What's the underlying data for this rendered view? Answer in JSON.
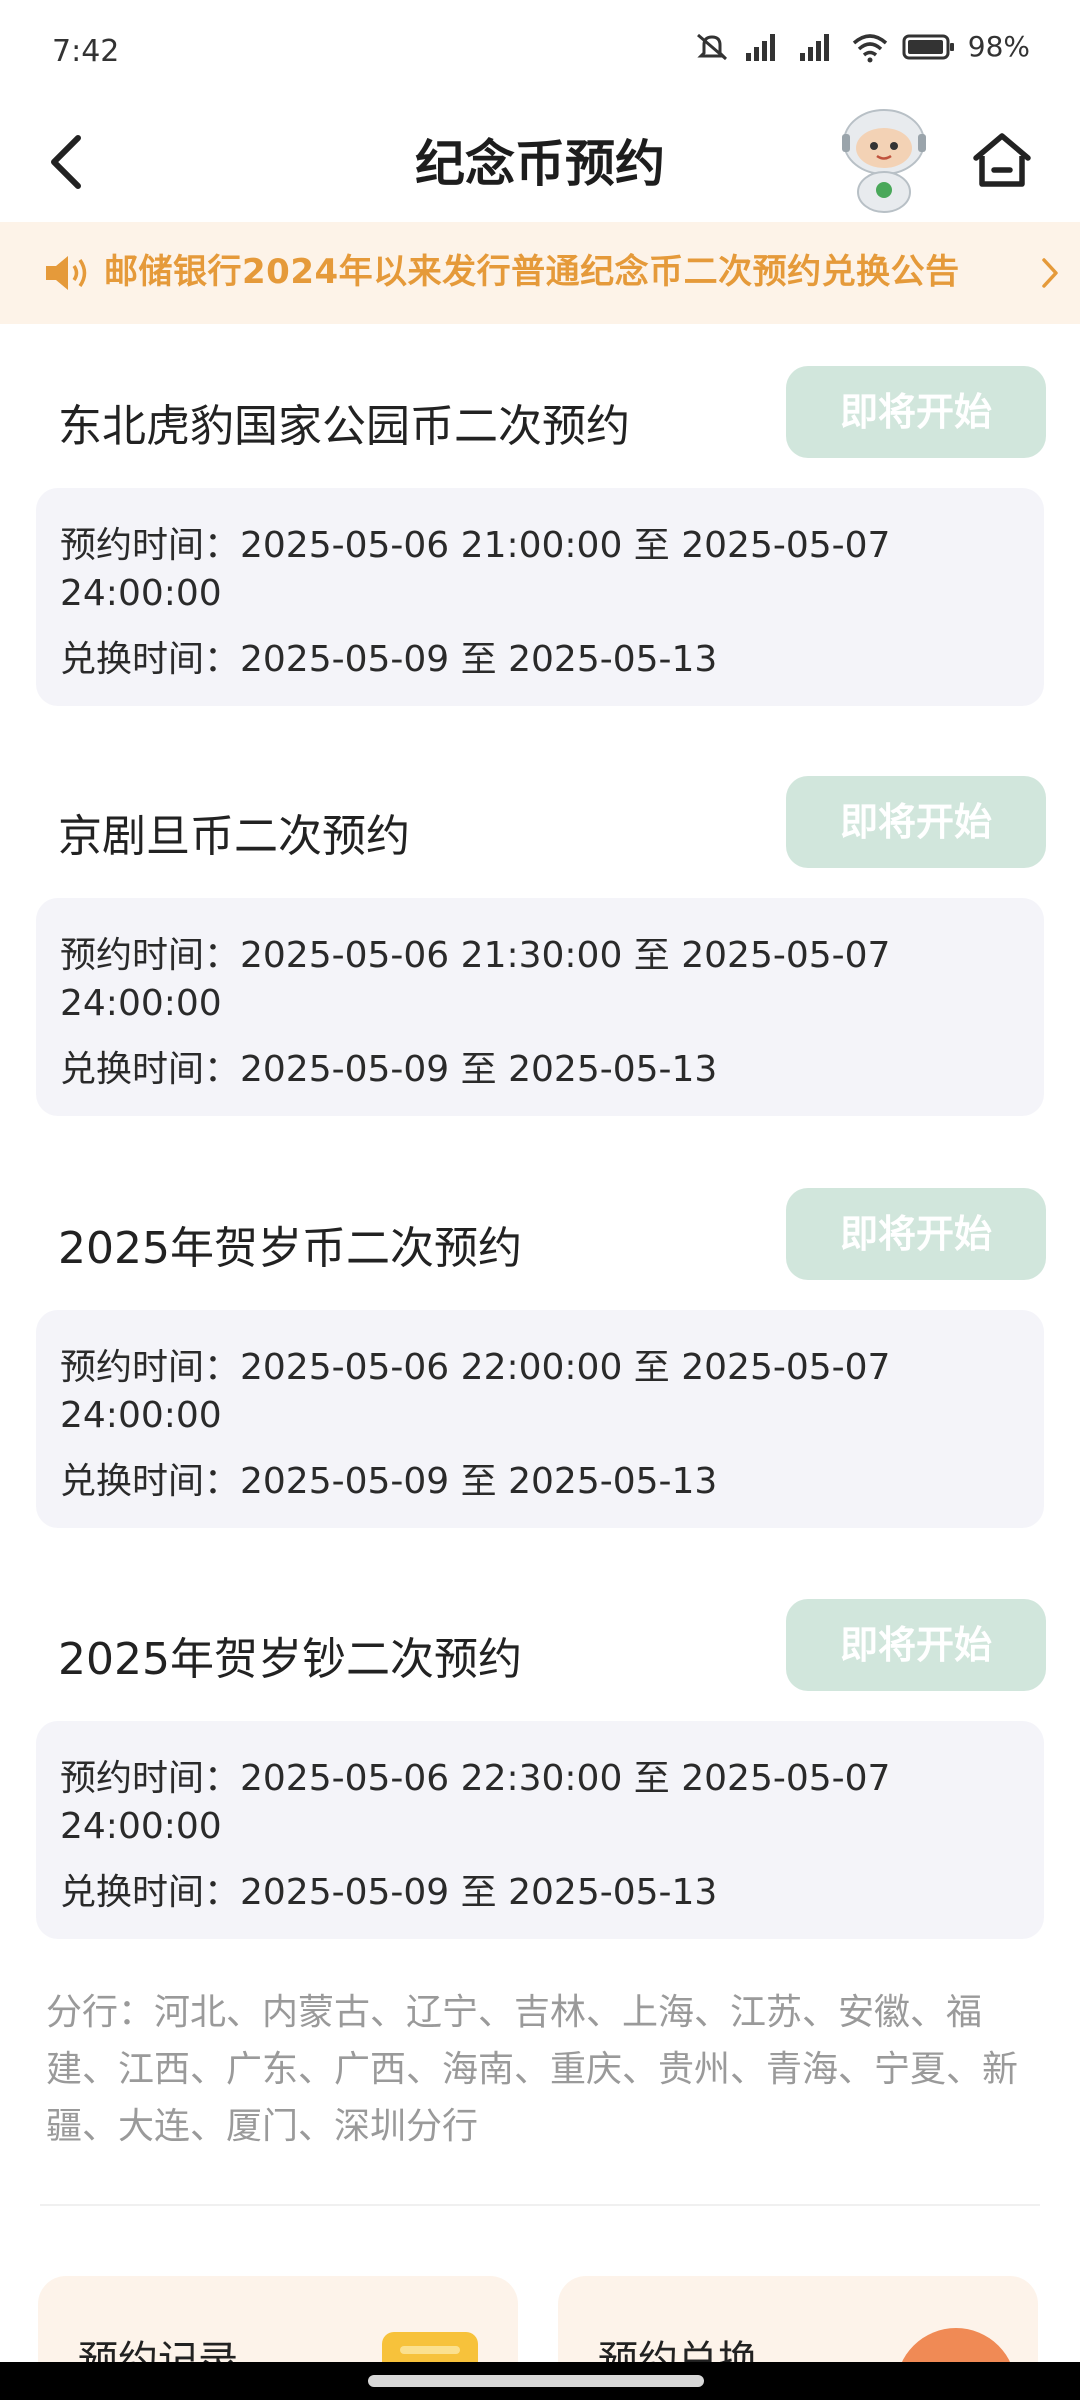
{
  "status_bar": {
    "time": "7:42",
    "battery": "98%"
  },
  "header": {
    "title": "纪念币预约"
  },
  "notice": {
    "text": "邮储银行2024年以来发行普通纪念币二次预约兑换公告"
  },
  "cards": [
    {
      "title": "东北虎豹国家公园币二次预约",
      "button": "即将开始",
      "line1": "预约时间：2025-05-06 21:00:00 至 2025-05-07",
      "line2": "24:00:00",
      "line3": "兑换时间：2025-05-09 至 2025-05-13"
    },
    {
      "title": "京剧旦币二次预约",
      "button": "即将开始",
      "line1": "预约时间：2025-05-06 21:30:00 至 2025-05-07",
      "line2": "24:00:00",
      "line3": "兑换时间：2025-05-09 至 2025-05-13"
    },
    {
      "title": "2025年贺岁币二次预约",
      "button": "即将开始",
      "line1": "预约时间：2025-05-06 22:00:00 至 2025-05-07",
      "line2": "24:00:00",
      "line3": "兑换时间：2025-05-09 至 2025-05-13"
    },
    {
      "title": "2025年贺岁钞二次预约",
      "button": "即将开始",
      "line1": "预约时间：2025-05-06 22:30:00 至 2025-05-07",
      "line2": "24:00:00",
      "line3": "兑换时间：2025-05-09 至 2025-05-13"
    }
  ],
  "branches": {
    "text": "分行：河北、内蒙古、辽宁、吉林、上海、江苏、安徽、福建、江西、广东、广西、海南、重庆、贵州、青海、宁夏、新疆、大连、厦门、深圳分行"
  },
  "tiles": {
    "left_label": "预约记录",
    "right_label": "预约兑换"
  },
  "colors": {
    "notice_bg": "#fdf3e8",
    "notice_text": "#e59a3a",
    "button_bg": "#d1e6dc",
    "card_bg": "#f4f4f9"
  },
  "icons": [
    "back-icon",
    "mascot-icon",
    "home-icon",
    "speaker-icon",
    "chevron-right-icon",
    "document-icon"
  ]
}
